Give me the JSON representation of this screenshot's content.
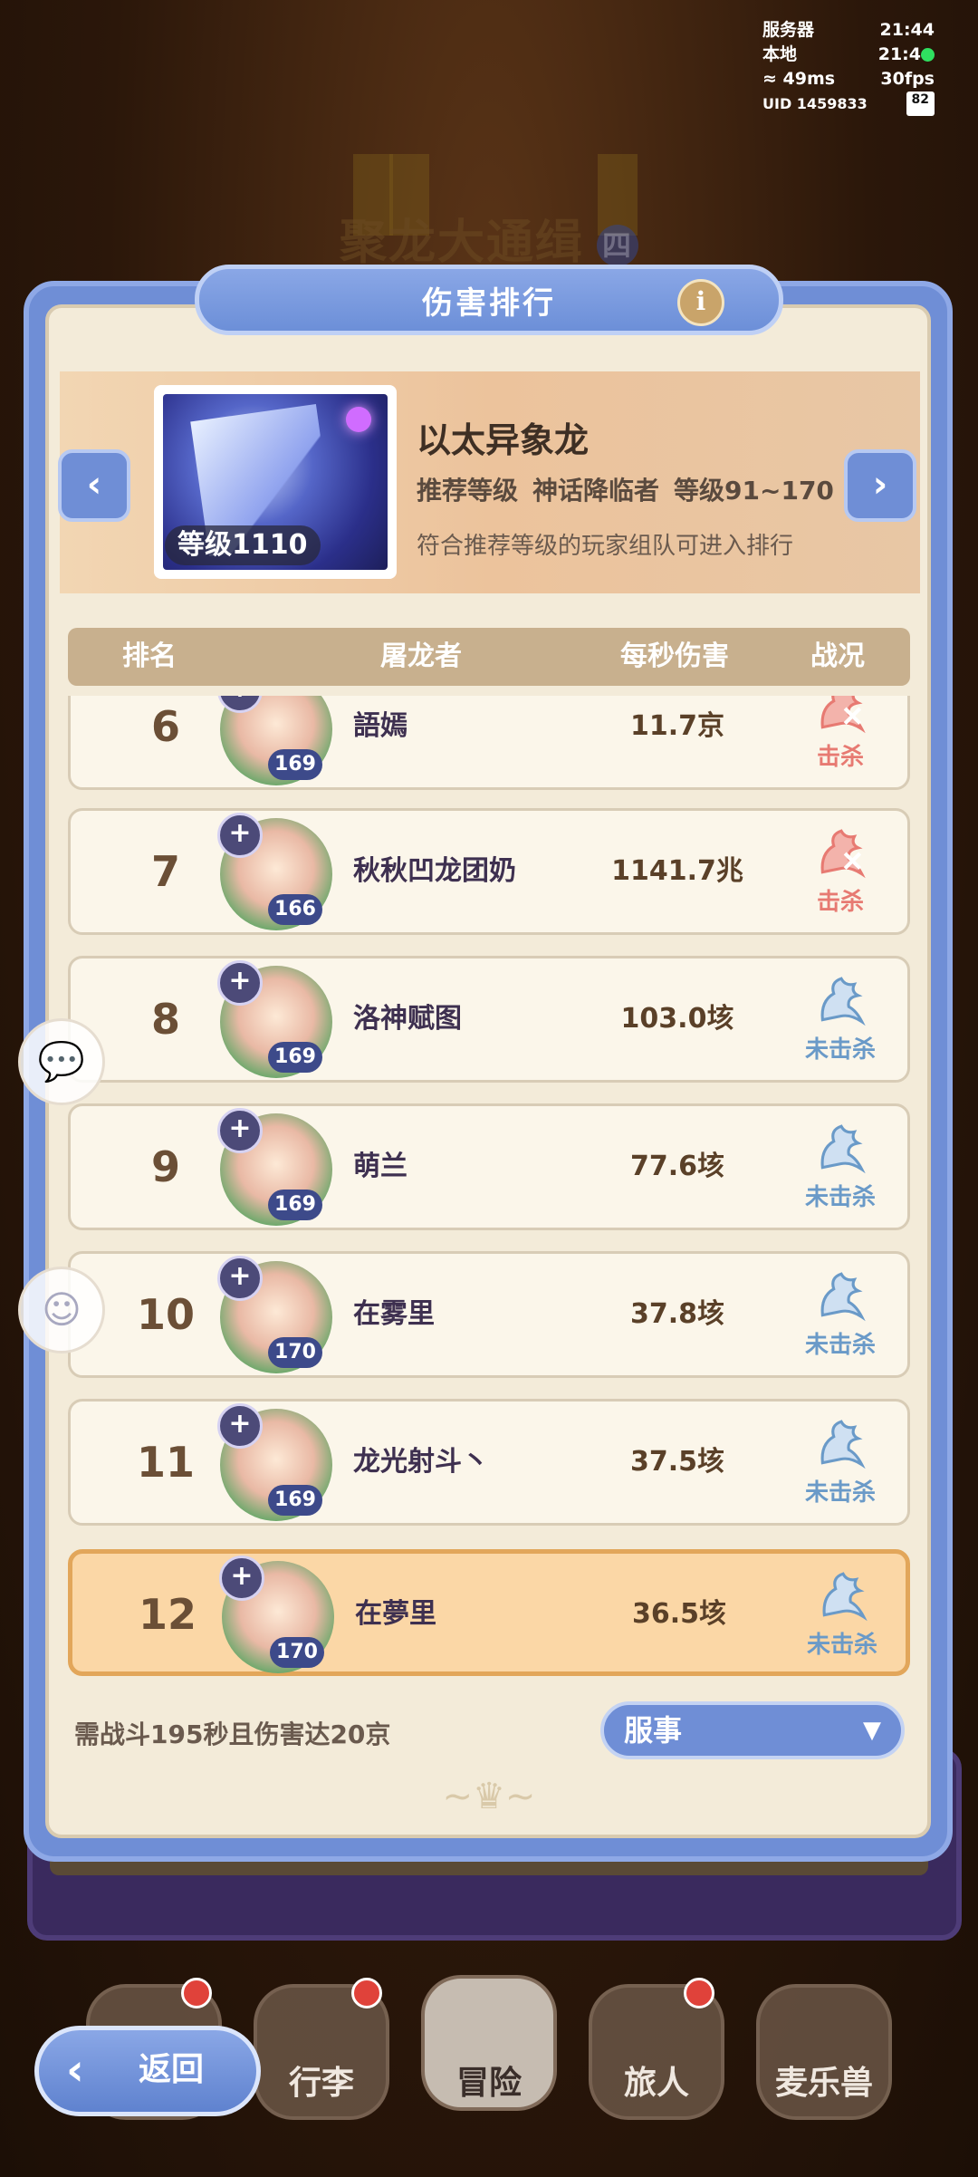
{
  "hud": {
    "server_label": "服务器",
    "server_time": "21:44",
    "local_label": "本地",
    "local_time": "21:4",
    "ping": "49ms",
    "fps": "30fps",
    "uid": "UID 1459833",
    "battery": "82"
  },
  "background": {
    "title": "聚龙大通缉",
    "badge": "四"
  },
  "dialog": {
    "title": "伤害排行",
    "info_icon": "info-icon"
  },
  "boss": {
    "name": "以太异象龙",
    "level_badge": "等级1110",
    "recommend": "推荐等级",
    "tier": "神话降临者",
    "level_range": "等级91~170",
    "note": "符合推荐等级的玩家组队可进入排行"
  },
  "table": {
    "headers": [
      "排名",
      "屠龙者",
      "每秒伤害",
      "战况"
    ],
    "rows": [
      {
        "rank": "6",
        "name": "語嫣",
        "level": "169",
        "dps": "11.7京",
        "status": "击杀",
        "killed": true
      },
      {
        "rank": "7",
        "name": "秋秋凹龙团奶",
        "level": "166",
        "dps": "1141.7兆",
        "status": "击杀",
        "killed": true
      },
      {
        "rank": "8",
        "name": "洛神赋图",
        "level": "169",
        "dps": "103.0垓",
        "status": "未击杀",
        "killed": false
      },
      {
        "rank": "9",
        "name": "萌兰",
        "level": "169",
        "dps": "77.6垓",
        "status": "未击杀",
        "killed": false
      },
      {
        "rank": "10",
        "name": "在雾里",
        "level": "170",
        "dps": "37.8垓",
        "status": "未击杀",
        "killed": false
      },
      {
        "rank": "11",
        "name": "龙光射斗丶",
        "level": "169",
        "dps": "37.5垓",
        "status": "未击杀",
        "killed": false
      },
      {
        "rank": "12",
        "name": "在夢里",
        "level": "170",
        "dps": "36.5垓",
        "status": "未击杀",
        "killed": false,
        "is_self": true
      }
    ]
  },
  "footer": {
    "requirement": "需战斗195秒且伤害达20京",
    "server_select": "服事"
  },
  "nav": {
    "back": "返回",
    "items": [
      "行李",
      "冒险",
      "旅人",
      "麦乐兽"
    ]
  },
  "colors": {
    "accent": "#6f8ed6",
    "kill": "#e77a72",
    "no_kill": "#6a9ac8",
    "self_row": "#fbd7a6"
  }
}
